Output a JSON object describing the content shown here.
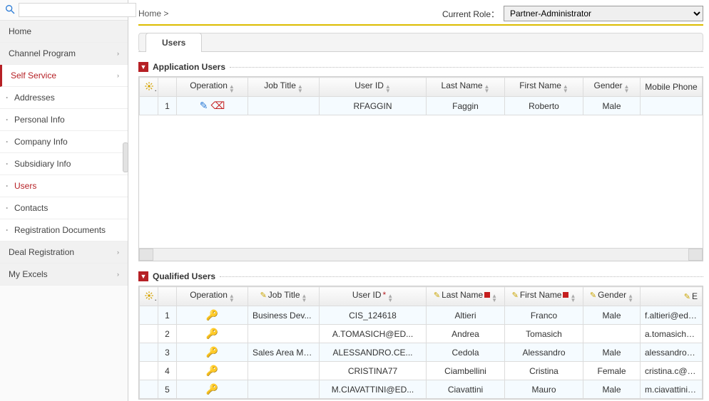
{
  "breadcrumb": "Home >",
  "current_role_label": "Current Role：",
  "current_role_value": "Partner-Administrator",
  "sidebar": {
    "search_placeholder": "",
    "items": [
      {
        "label": "Home",
        "kind": "top",
        "expand": false,
        "active": false
      },
      {
        "label": "Channel Program",
        "kind": "top",
        "expand": true,
        "active": false
      },
      {
        "label": "Self Service",
        "kind": "top",
        "expand": true,
        "active": true
      },
      {
        "label": "Addresses",
        "kind": "sub",
        "active": false
      },
      {
        "label": "Personal Info",
        "kind": "sub",
        "active": false
      },
      {
        "label": "Company Info",
        "kind": "sub",
        "active": false
      },
      {
        "label": "Subsidiary Info",
        "kind": "sub",
        "active": false
      },
      {
        "label": "Users",
        "kind": "sub",
        "active": true
      },
      {
        "label": "Contacts",
        "kind": "sub",
        "active": false
      },
      {
        "label": "Registration Documents",
        "kind": "sub",
        "active": false
      },
      {
        "label": "Deal Registration",
        "kind": "top",
        "expand": true,
        "active": false
      },
      {
        "label": "My Excels",
        "kind": "top",
        "expand": true,
        "active": false
      }
    ]
  },
  "tabs": [
    {
      "label": "Users",
      "active": true
    }
  ],
  "sections": {
    "app_users_title": "Application Users",
    "qual_users_title": "Qualified Users"
  },
  "columns": {
    "operation": "Operation",
    "job_title": "Job Title",
    "user_id": "User ID",
    "last_name": "Last Name",
    "first_name": "First Name",
    "gender": "Gender",
    "mobile_phone": "Mobile Phone",
    "email_trunc": "E"
  },
  "app_users": [
    {
      "n": "1",
      "job": "",
      "uid": "RFAGGIN",
      "ln": "Faggin",
      "fn": "Roberto",
      "gen": "Male",
      "tail": ""
    }
  ],
  "qual_users": [
    {
      "n": "1",
      "job": "Business Dev...",
      "uid": "CIS_124618",
      "ln": "Altieri",
      "fn": "Franco",
      "gen": "Male",
      "tail": "f.altieri@edslan"
    },
    {
      "n": "2",
      "job": "",
      "uid": "A.TOMASICH@ED...",
      "ln": "Andrea",
      "fn": "Tomasich",
      "gen": "",
      "tail": "a.tomasich@ed"
    },
    {
      "n": "3",
      "job": "Sales Area Ma...",
      "uid": "ALESSANDRO.CE...",
      "ln": "Cedola",
      "fn": "Alessandro",
      "gen": "Male",
      "tail": "alessandro.ced"
    },
    {
      "n": "4",
      "job": "",
      "uid": "CRISTINA77",
      "ln": "Ciambellini",
      "fn": "Cristina",
      "gen": "Female",
      "tail": "cristina.c@edsl"
    },
    {
      "n": "5",
      "job": "",
      "uid": "M.CIAVATTINI@ED...",
      "ln": "Ciavattini",
      "fn": "Mauro",
      "gen": "Male",
      "tail": "m.ciavattini@ed"
    }
  ]
}
